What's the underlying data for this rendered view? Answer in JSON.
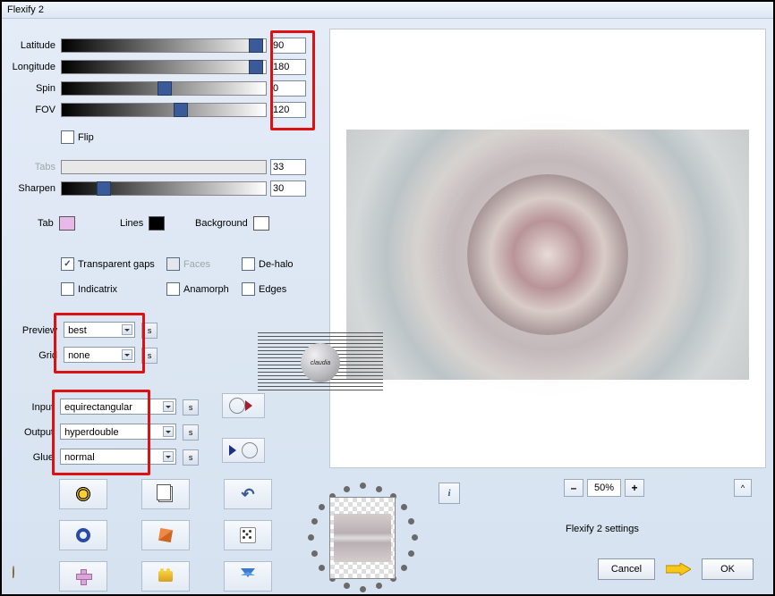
{
  "title": "Flexify 2",
  "sliders": {
    "latitude": {
      "label": "Latitude",
      "value": "90",
      "pos": 98
    },
    "longitude": {
      "label": "Longitude",
      "value": "180",
      "pos": 98
    },
    "spin": {
      "label": "Spin",
      "value": "0",
      "pos": 50
    },
    "fov": {
      "label": "FOV",
      "value": "120",
      "pos": 58
    },
    "tabs": {
      "label": "Tabs",
      "value": "33",
      "pos": 0,
      "disabled": true
    },
    "sharpen": {
      "label": "Sharpen",
      "value": "30",
      "pos": 20
    }
  },
  "flip": {
    "label": "Flip",
    "checked": false
  },
  "swatches": {
    "tab": {
      "label": "Tab",
      "color": "#e8b8e8"
    },
    "lines": {
      "label": "Lines",
      "color": "#000000"
    },
    "background": {
      "label": "Background",
      "color": "#ffffff"
    }
  },
  "checks": {
    "transparent_gaps": {
      "label": "Transparent gaps",
      "checked": true
    },
    "faces": {
      "label": "Faces",
      "checked": false,
      "disabled": true
    },
    "dehalo": {
      "label": "De-halo",
      "checked": false
    },
    "indicatrix": {
      "label": "Indicatrix",
      "checked": false
    },
    "anamorph": {
      "label": "Anamorph",
      "checked": false
    },
    "edges": {
      "label": "Edges",
      "checked": false
    }
  },
  "preview_sel": {
    "label": "Preview",
    "value": "best"
  },
  "grid_sel": {
    "label": "Grid",
    "value": "none"
  },
  "input_sel": {
    "label": "Input",
    "value": "equirectangular"
  },
  "output_sel": {
    "label": "Output",
    "value": "hyperdouble"
  },
  "glue_sel": {
    "label": "Glue",
    "value": "normal"
  },
  "zoom": {
    "value": "50%",
    "minus": "–",
    "plus": "+",
    "caret": "^"
  },
  "info": "i",
  "settings_text": "Flexify 2 settings",
  "buttons": {
    "cancel": "Cancel",
    "ok": "OK"
  },
  "s_label": "s",
  "watermark": "claudia"
}
